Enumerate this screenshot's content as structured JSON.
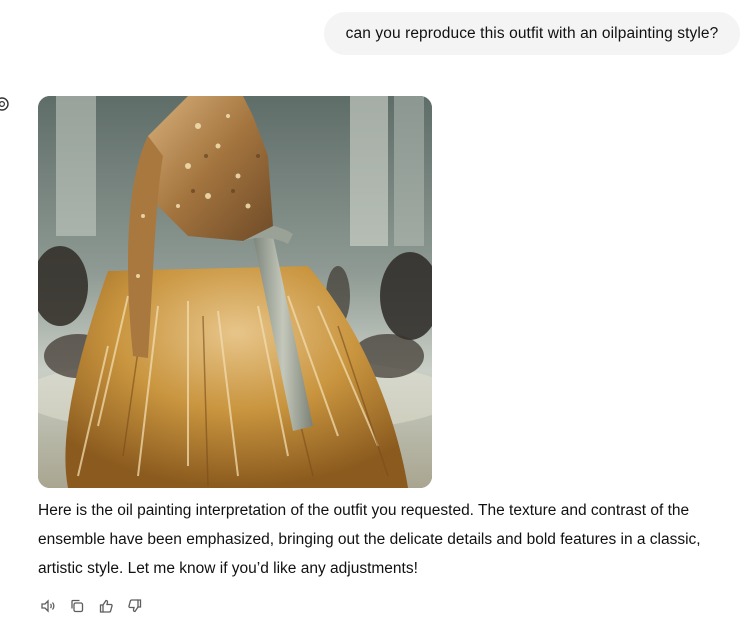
{
  "conversation": {
    "user_message": "can you reproduce this outfit with an oilpainting style?",
    "assistant_reply": "Here is the oil painting interpretation of the outfit you requested. The texture and contrast of the ensemble have been emphasized, bringing out the delicate details and bold features in a classic, artistic style. Let me know if you’d like any adjustments!"
  },
  "image": {
    "alt": "Oil painting style rendering of an embellished gown with a fur skirt"
  },
  "actions": [
    {
      "name": "read-aloud",
      "icon": "speaker-icon"
    },
    {
      "name": "copy",
      "icon": "copy-icon"
    },
    {
      "name": "good-response",
      "icon": "thumbs-up-icon"
    },
    {
      "name": "bad-response",
      "icon": "thumbs-down-icon"
    }
  ],
  "colors": {
    "user_bubble": "#f4f4f4",
    "text": "#111111",
    "icon": "#5d5d5d"
  }
}
